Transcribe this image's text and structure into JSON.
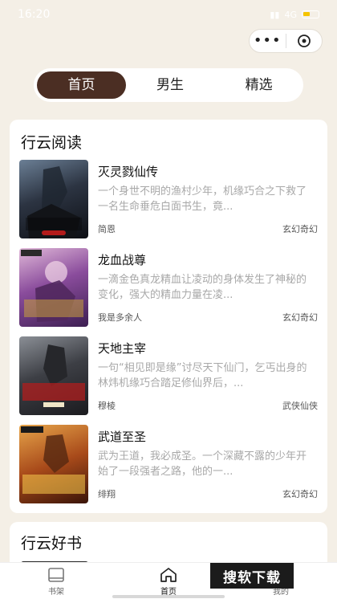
{
  "status": {
    "time": "16:20",
    "net": "4G"
  },
  "tabs": [
    {
      "label": "首页",
      "active": true
    },
    {
      "label": "男生",
      "active": false
    },
    {
      "label": "精选",
      "active": false
    }
  ],
  "section1": {
    "title": "行云阅读",
    "books": [
      {
        "title": "灭灵戮仙传",
        "desc": "一个身世不明的渔村少年，机缘巧合之下救了一名生命垂危白面书生，竟...",
        "author": "简恩",
        "genre": "玄幻奇幻"
      },
      {
        "title": "龙血战尊",
        "desc": "一滴金色真龙精血让凌动的身体发生了神秘的变化，强大的精血力量在凌...",
        "author": "我是多余人",
        "genre": "玄幻奇幻"
      },
      {
        "title": "天地主宰",
        "desc": "一句“相见即是缘”讨尽天下仙门，乞丐出身的林炜机缘巧合踏足修仙界后，...",
        "author": "穆棱",
        "genre": "武侠仙侠"
      },
      {
        "title": "武道至圣",
        "desc": "武为王道，我必成圣。一个深藏不露的少年开始了一段强者之路，他的一...",
        "author": "绯翔",
        "genre": "玄幻奇幻"
      }
    ]
  },
  "section2": {
    "title": "行云好书"
  },
  "nav": [
    {
      "label": "书架",
      "icon": "book-icon"
    },
    {
      "label": "首页",
      "icon": "home-icon"
    },
    {
      "label": "我的",
      "icon": "user-icon"
    }
  ],
  "watermark": "搜软下载",
  "colors": {
    "accent": "#4b2e23",
    "background": "#f4efe6"
  }
}
